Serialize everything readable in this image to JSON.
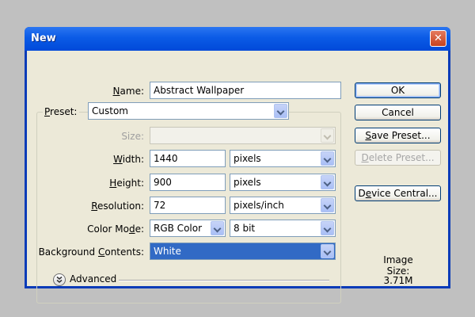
{
  "window": {
    "title": "New",
    "close_label": "✕"
  },
  "form": {
    "name": {
      "label_pre": "",
      "label_u": "N",
      "label_post": "ame:",
      "value": "Abstract Wallpaper"
    },
    "preset": {
      "label_pre": "",
      "label_u": "P",
      "label_post": "reset:",
      "value": "Custom"
    },
    "size": {
      "label": "Size:",
      "value": ""
    },
    "width": {
      "label_pre": "",
      "label_u": "W",
      "label_post": "idth:",
      "value": "1440",
      "unit": "pixels"
    },
    "height": {
      "label_pre": "",
      "label_u": "H",
      "label_post": "eight:",
      "value": "900",
      "unit": "pixels"
    },
    "resolution": {
      "label_pre": "",
      "label_u": "R",
      "label_post": "esolution:",
      "value": "72",
      "unit": "pixels/inch"
    },
    "color_mode": {
      "label_pre": "Color Mo",
      "label_u": "d",
      "label_post": "e:",
      "value": "RGB Color",
      "depth": "8 bit"
    },
    "background": {
      "label_pre": "Background ",
      "label_u": "C",
      "label_post": "ontents:",
      "value": "White"
    },
    "advanced": {
      "label": "Advanced"
    }
  },
  "buttons": {
    "ok": "OK",
    "cancel": "Cancel",
    "save_preset": {
      "pre": "",
      "u": "S",
      "post": "ave Preset..."
    },
    "delete_preset": {
      "pre": "",
      "u": "D",
      "post": "elete Preset..."
    },
    "device_central": {
      "pre": "D",
      "u": "e",
      "post": "vice Central..."
    }
  },
  "image_size": {
    "label": "Image Size:",
    "value": "3.71M"
  }
}
